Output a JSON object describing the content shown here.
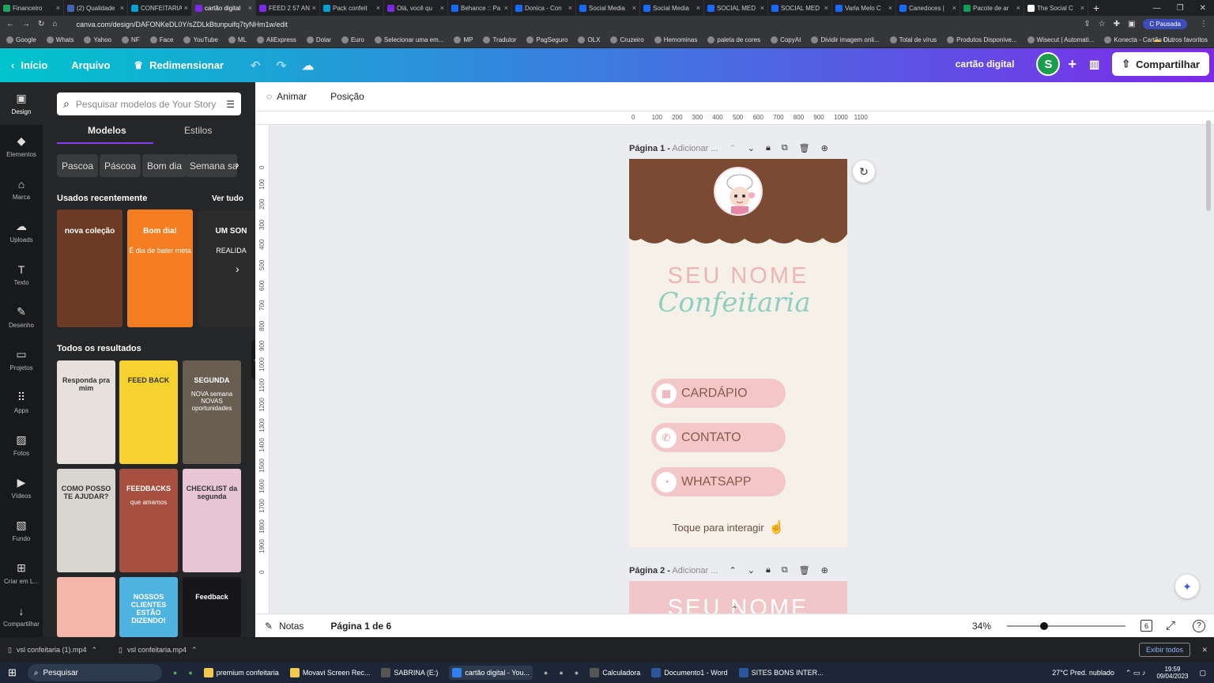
{
  "browser": {
    "tabs": [
      {
        "label": "Financeiro",
        "color": "#1ea362"
      },
      {
        "label": "(2) Qualidade",
        "color": "#4267b2"
      },
      {
        "label": "CONFEITARIA",
        "color": "#00a2d6"
      },
      {
        "label": "cartão digital",
        "color": "#7d2ae8",
        "active": true
      },
      {
        "label": "FEED 2 57 AN",
        "color": "#7d2ae8"
      },
      {
        "label": "Pack confeit",
        "color": "#00a2d6"
      },
      {
        "label": "Olá, você qu",
        "color": "#7d2ae8"
      },
      {
        "label": "Behance :: Pa",
        "color": "#1769ff"
      },
      {
        "label": "Donica - Con",
        "color": "#1769ff"
      },
      {
        "label": "Social Media",
        "color": "#1769ff"
      },
      {
        "label": "Social Media",
        "color": "#1769ff"
      },
      {
        "label": "SOCIAL MED",
        "color": "#1769ff"
      },
      {
        "label": "SOCIAL MED",
        "color": "#1769ff"
      },
      {
        "label": "Varla Melo C",
        "color": "#1769ff"
      },
      {
        "label": "Canedoces |",
        "color": "#1769ff"
      },
      {
        "label": "Pacote de ar",
        "color": "#0f9d58"
      },
      {
        "label": "The Social C",
        "color": "#ffffff"
      }
    ],
    "url": "canva.com/design/DAFONKeDL0Y/sZDLkBtunpuifq7tyNHm1w/edit",
    "profile_status": "Pausada",
    "bookmarks": [
      "Google",
      "Whats",
      "Yahoo",
      "NF",
      "Face",
      "YouTube",
      "ML",
      "AliExpress",
      "Dolar",
      "Euro",
      "Selecionar uma em...",
      "MP",
      "Tradutor",
      "PagSeguro",
      "OLX",
      "Cruzeiro",
      "Hemominas",
      "paleta de cores",
      "CopyAI",
      "Dividir imagem onli...",
      "Total de vírus",
      "Produtos Disponíve...",
      "Wisecut | Automati...",
      "Konecta - Cartão Di..."
    ],
    "bookmarks_other": "Outros favoritos"
  },
  "header": {
    "home": "Início",
    "file": "Arquivo",
    "resize": "Redimensionar",
    "design_title": "cartão digital",
    "avatar_letter": "S",
    "share": "Compartilhar"
  },
  "rail": [
    {
      "label": "Design",
      "icon": "layout-icon"
    },
    {
      "label": "Elementos",
      "icon": "shapes-icon"
    },
    {
      "label": "Marca",
      "icon": "brand-icon"
    },
    {
      "label": "Uploads",
      "icon": "cloud-upload-icon"
    },
    {
      "label": "Texto",
      "icon": "text-icon"
    },
    {
      "label": "Desenho",
      "icon": "draw-icon"
    },
    {
      "label": "Projetos",
      "icon": "folder-icon"
    },
    {
      "label": "Apps",
      "icon": "apps-icon"
    },
    {
      "label": "Fotos",
      "icon": "photo-icon"
    },
    {
      "label": "Vídeos",
      "icon": "video-icon"
    },
    {
      "label": "Fundo",
      "icon": "background-icon"
    },
    {
      "label": "Criar em L...",
      "icon": "create-icon"
    },
    {
      "label": "Compartilhar",
      "icon": "download-icon"
    }
  ],
  "panel": {
    "search_placeholder": "Pesquisar modelos de Your Story",
    "tab_templates": "Modelos",
    "tab_styles": "Estilos",
    "chips": [
      "Pascoa",
      "Páscoa",
      "Bom dia",
      "Semana sa"
    ],
    "recent_title": "Usados recentemente",
    "see_all": "Ver tudo",
    "all_results": "Todos os resultados",
    "recent_templates": [
      {
        "text": "nova coleção",
        "bg": "#6b3b26"
      },
      {
        "text": "Bom dia!",
        "sub": "É dia de bater meta",
        "bg": "#f57c1f"
      },
      {
        "text": "UM SON",
        "sub": "REALIDA",
        "bg": "#2b2b2b"
      }
    ],
    "results": [
      {
        "text": "Responda pra mim",
        "bg": "#e6e1dc"
      },
      {
        "text": "FEED BACK",
        "bg": "#f7d22f"
      },
      {
        "text": "SEGUNDA",
        "sub": "NOVA semana NOVAS oportunidades",
        "bg": "#6a5e53"
      },
      {
        "text": "COMO POSSO TE AJUDAR?",
        "bg": "#d9d6d2"
      },
      {
        "text": "FEEDBACKS",
        "sub": "que amamos",
        "bg": "#a8503f"
      },
      {
        "text": "CHECKLIST da segunda",
        "bg": "#e7c5d4"
      },
      {
        "text": "",
        "bg": "#f3b6a8"
      },
      {
        "text": "NOSSOS CLIENTES ESTÃO DIZENDO!",
        "bg": "#4fb3e0"
      },
      {
        "text": "Feedback",
        "bg": "#17161a"
      }
    ]
  },
  "toolbar": {
    "animate": "Animar",
    "position": "Posição"
  },
  "ruler": {
    "h": [
      "0",
      "100",
      "200",
      "300",
      "400",
      "500",
      "600",
      "700",
      "800",
      "900",
      "1000",
      "1100"
    ],
    "v": [
      "0",
      "100",
      "200",
      "300",
      "400",
      "500",
      "600",
      "700",
      "800",
      "900",
      "1000",
      "1100",
      "1200",
      "1300",
      "1400",
      "1500",
      "1600",
      "1700",
      "1800",
      "1900",
      "0"
    ]
  },
  "pages": {
    "page1_label": "Página 1 -",
    "page1_title_placeholder": "Adicionar ...",
    "page2_label": "Página 2 -",
    "page2_title_placeholder": "Adicionar ...",
    "card": {
      "name": "SEU NOME",
      "subtitle": "Confeitaria",
      "buttons": [
        {
          "label": "CARDÁPIO",
          "icon": "menu-card-icon"
        },
        {
          "label": "CONTATO",
          "icon": "phone-icon"
        },
        {
          "label": "WHATSAPP",
          "icon": "whatsapp-icon"
        }
      ],
      "tap_hint": "Toque para interagir",
      "colors": {
        "brown": "#7a4a32",
        "cream": "#f5f1e8",
        "pink": "#f3c6c8",
        "mint": "#8fcfc0",
        "name_pink": "#f0b4b4"
      }
    },
    "page2_name": "SEU NOME"
  },
  "bottom": {
    "notes": "Notas",
    "page_indicator": "Página 1 de 6",
    "zoom": "34%",
    "zoom_fraction": 0.31,
    "page_count": "6"
  },
  "downloads": [
    "vsl confeitaria (1).mp4",
    "vsl confeitaria.mp4"
  ],
  "downloads_show_all": "Exibir todos",
  "taskbar": {
    "search": "Pesquisar",
    "apps": [
      "premium confeitaria",
      "Movavi Screen Rec...",
      "SABRINA (E:)",
      "cartão digital - You...",
      "Calculadora",
      "Documento1 - Word",
      "SITES BONS INTER..."
    ],
    "weather": "27°C  Pred. nublado",
    "time": "19:59",
    "date": "09/04/2023"
  }
}
